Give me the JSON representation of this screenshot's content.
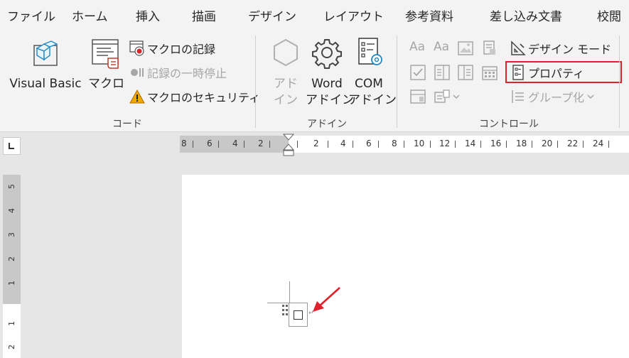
{
  "menu": {
    "tabs": [
      "ファイル",
      "ホーム",
      "挿入",
      "描画",
      "デザイン",
      "レイアウト",
      "参考資料",
      "差し込み文書",
      "校閲"
    ]
  },
  "ribbon": {
    "code_group": {
      "label": "コード",
      "visual_basic": "Visual Basic",
      "macro": "マクロ",
      "record_macro": "マクロの記録",
      "pause_recording": "記録の一時停止",
      "macro_security": "マクロのセキュリティ"
    },
    "addin_group": {
      "label": "アドイン",
      "addin_line1": "アド",
      "addin_line2": "イン",
      "word_addin_line1": "Word",
      "word_addin_line2": "アドイン",
      "com_addin_line1": "COM",
      "com_addin_line2": "アドイン"
    },
    "controls_group": {
      "label": "コントロール",
      "design_mode": "デザイン モード",
      "properties": "プロパティ",
      "group": "グループ化",
      "aa_rich": "Aa",
      "aa_plain": "Aa"
    }
  },
  "ruler": {
    "left_numbers": [
      "8",
      "6",
      "4",
      "2"
    ],
    "right_numbers": [
      "2",
      "4",
      "6",
      "8",
      "10",
      "12",
      "14",
      "16",
      "18",
      "20",
      "22",
      "24"
    ],
    "vertical_numbers": [
      "5",
      "4",
      "3",
      "2",
      "1",
      "1",
      "2"
    ]
  },
  "colors": {
    "highlight": "#e0202a",
    "arrow": "#e0202a",
    "ribbon_bg": "#f3f3f3",
    "canvas_bg": "#e6e6e6"
  }
}
